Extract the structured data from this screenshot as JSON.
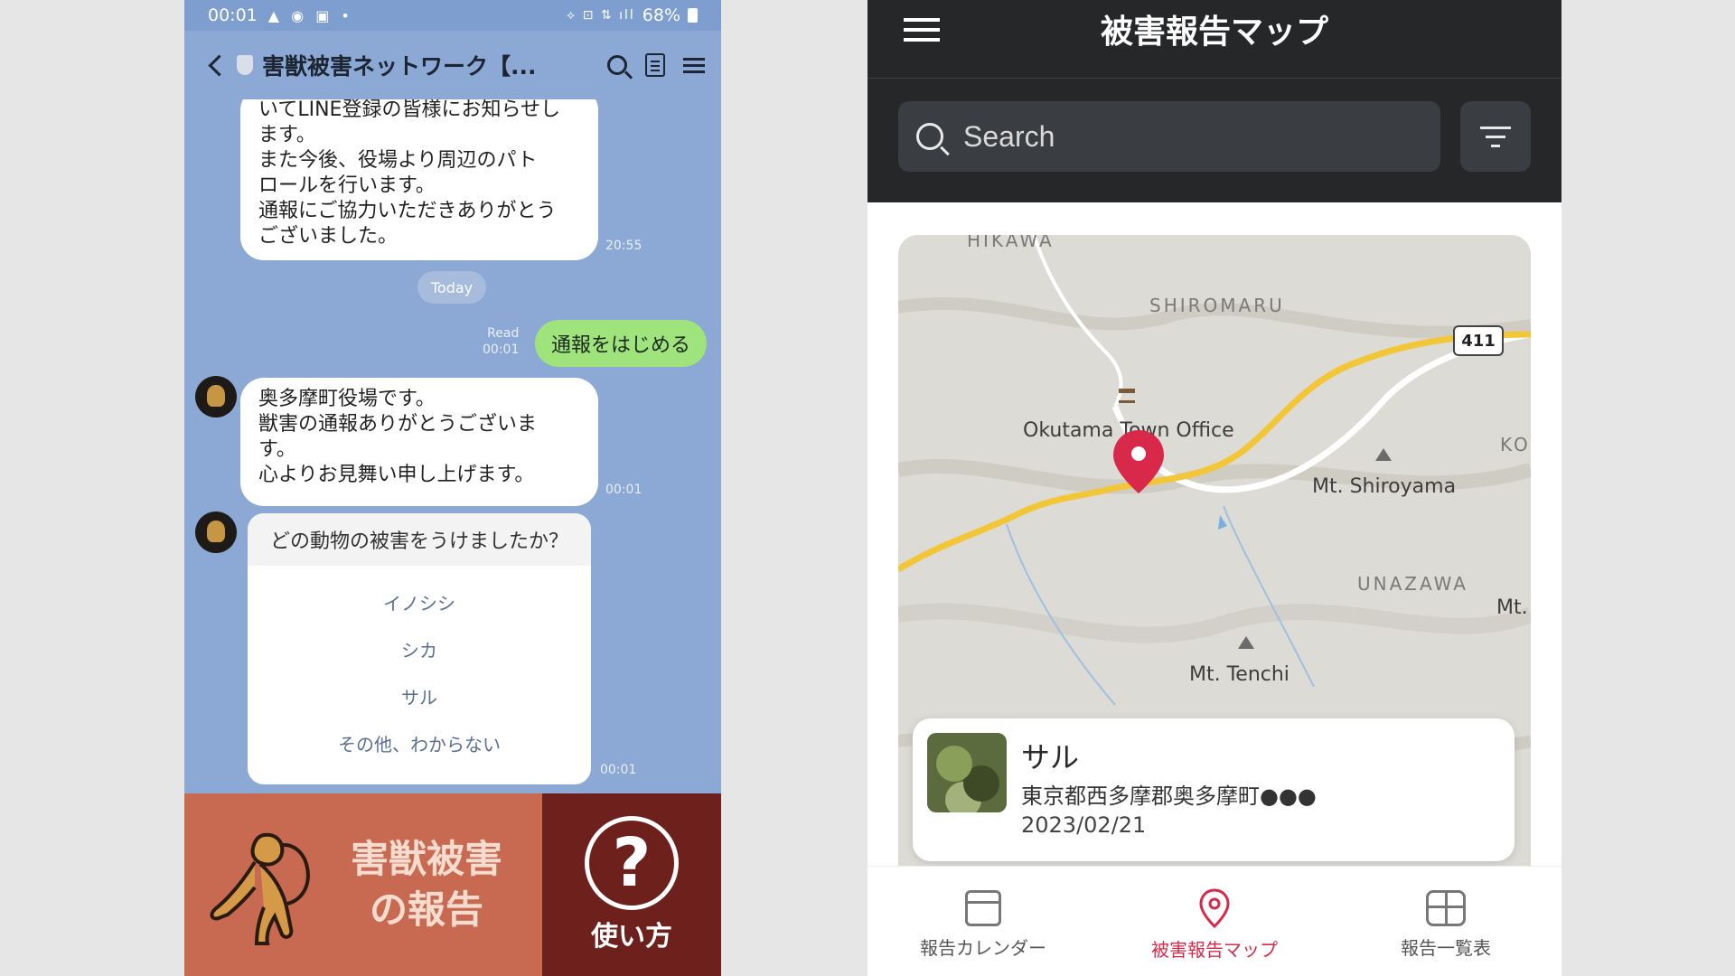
{
  "line_app": {
    "status_bar": {
      "time": "00:01",
      "battery": "68%"
    },
    "header": {
      "title": "害獣被害ネットワーク【..."
    },
    "messages": [
      {
        "lines": [
          "いてLINE登録の皆様にお知らせし",
          "ます。",
          "また今後、役場より周辺のパト",
          "ロールを行います。",
          "通報にご協力いただきありがとう",
          "ございました。"
        ],
        "time": "20:55"
      }
    ],
    "date_divider": "Today",
    "sent": {
      "text": "通報をはじめる",
      "read": "Read",
      "time": "00:01"
    },
    "reply": {
      "lines": [
        "奥多摩町役場です。",
        "獣害の通報ありがとうございま",
        "す。",
        "心よりお見舞い申し上げます。"
      ],
      "time": "00:01"
    },
    "question": {
      "text": "どの動物の被害をうけましたか？",
      "options": [
        "イノシシ",
        "シカ",
        "サル",
        "その他、わからない"
      ],
      "time": "00:01"
    },
    "rich_menu": {
      "report_line1": "害獣被害",
      "report_line2": "の報告",
      "howto_label": "使い方",
      "howto_glyph": "?"
    }
  },
  "map_app": {
    "title": "被害報告マップ",
    "search": {
      "placeholder": "Search"
    },
    "map": {
      "labels": {
        "hikawa": "HIKAWA",
        "shiromaru": "SHIROMARU",
        "office": "Okutama Town Office",
        "shiroyama": "Mt. Shiroyama",
        "unazawa": "UNAZAWA",
        "tenchi": "Mt. Tenchi",
        "ko": "KO",
        "mt": "Mt.",
        "route": "411"
      }
    },
    "report_card": {
      "title": "サル",
      "address": "東京都西多摩郡奥多摩町●●●",
      "date": "2023/02/21"
    },
    "nav": {
      "calendar": "報告カレンダー",
      "map": "被害報告マップ",
      "list": "報告一覧表"
    },
    "colors": {
      "accent": "#d8294a",
      "header": "#252729"
    }
  }
}
